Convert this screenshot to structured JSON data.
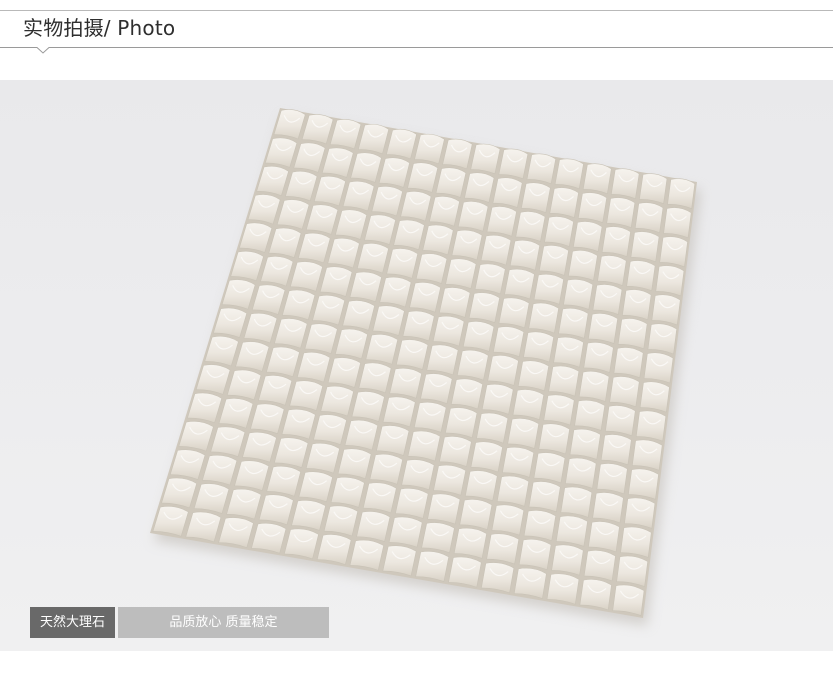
{
  "header": {
    "title": "实物拍摄/ Photo"
  },
  "photo": {
    "subject": "mosaic-tile-sheet",
    "background_color": "#ebebed",
    "tile_color": "#efebe4",
    "tile_shadow_color": "#c9c3b7",
    "grid_rows": 15,
    "grid_cols": 15
  },
  "badge": {
    "left_text": "天然大理石",
    "right_text": "品质放心 质量稳定",
    "left_color": "#696969",
    "right_color": "#bdbdbd"
  }
}
